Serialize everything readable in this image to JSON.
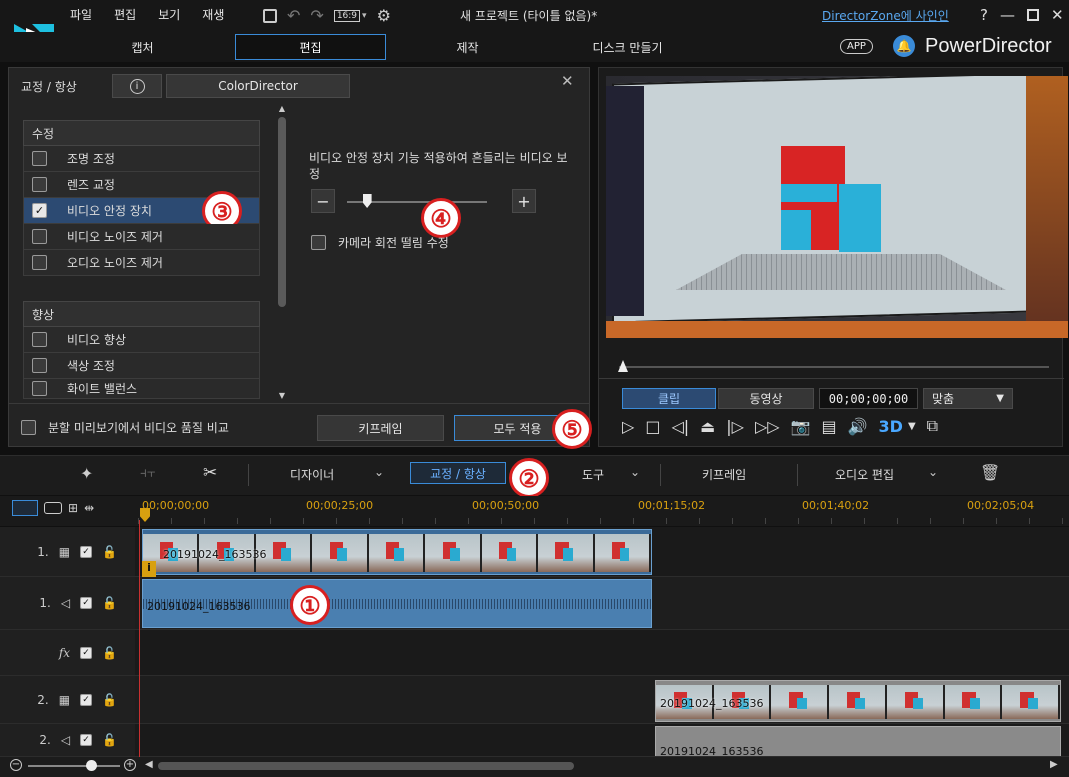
{
  "menu": [
    "파일",
    "편집",
    "보기",
    "재생"
  ],
  "window_title": "새 프로젝트 (타이틀 없음)*",
  "aspect": "16:9",
  "signin": "DirectorZone에 사인인",
  "mode_tabs": [
    {
      "label": "캡처"
    },
    {
      "label": "편집"
    },
    {
      "label": "제작"
    },
    {
      "label": "디스크 만들기"
    }
  ],
  "app_badge": "APP",
  "brand": "PowerDirector",
  "panel": {
    "title": "교정 / 항상",
    "info": "i",
    "colordirector": "ColorDirector",
    "close": "✕",
    "section1": "수정",
    "fix_items": [
      {
        "label": "조명 조정",
        "checked": false
      },
      {
        "label": "렌즈 교정",
        "checked": false
      },
      {
        "label": "비디오 안정 장치",
        "checked": true
      },
      {
        "label": "비디오 노이즈 제거",
        "checked": false
      },
      {
        "label": "오디오 노이즈 제거",
        "checked": false
      }
    ],
    "section2": "향상",
    "enh_items": [
      {
        "label": "비디오 향상",
        "checked": false
      },
      {
        "label": "색상 조정",
        "checked": false
      },
      {
        "label": "화이트 밸런스",
        "checked": false
      }
    ],
    "stab_desc": "비디오 안정 장치 기능 적용하여 흔들리는 비디오 보정",
    "minus": "−",
    "plus": "+",
    "slider_level": 0.14,
    "camera_rot": "카메라 회전 떨림 수정",
    "split_compare": "분할 미리보기에서 비디오 품질 비교",
    "keyframe": "키프레임",
    "apply_all": "모두 적용"
  },
  "annotations": {
    "n1": "①",
    "n2": "②",
    "n3": "③",
    "n4": "④",
    "n5": "⑤"
  },
  "preview": {
    "clip": "클립",
    "movie": "동영상",
    "timecode": "00;00;00;00",
    "fit": "맞춤",
    "three_d": "3D"
  },
  "toolbar": {
    "designer": "디자이너",
    "fix_enhance": "교정 / 항상",
    "tools": "도구",
    "keyframe": "키프레임",
    "audio_edit": "오디오 편집"
  },
  "ruler": [
    "00;00;00;00",
    "00;00;25;00",
    "00;00;50;00",
    "00;01;15;02",
    "00;01;40;02",
    "00;02;05;04"
  ],
  "tracks": [
    {
      "num": "1."
    },
    {
      "num": "1."
    },
    {
      "num": "fx"
    },
    {
      "num": "2."
    },
    {
      "num": "2."
    }
  ],
  "clips": {
    "v1": "20191024_163536",
    "a1": "20191024_163536",
    "v2": "20191024_163536",
    "a2": "20191024_163536"
  },
  "colors": {
    "accent": "#3a8bd8",
    "clip": "#4a7fb0",
    "red": "#d82020"
  }
}
